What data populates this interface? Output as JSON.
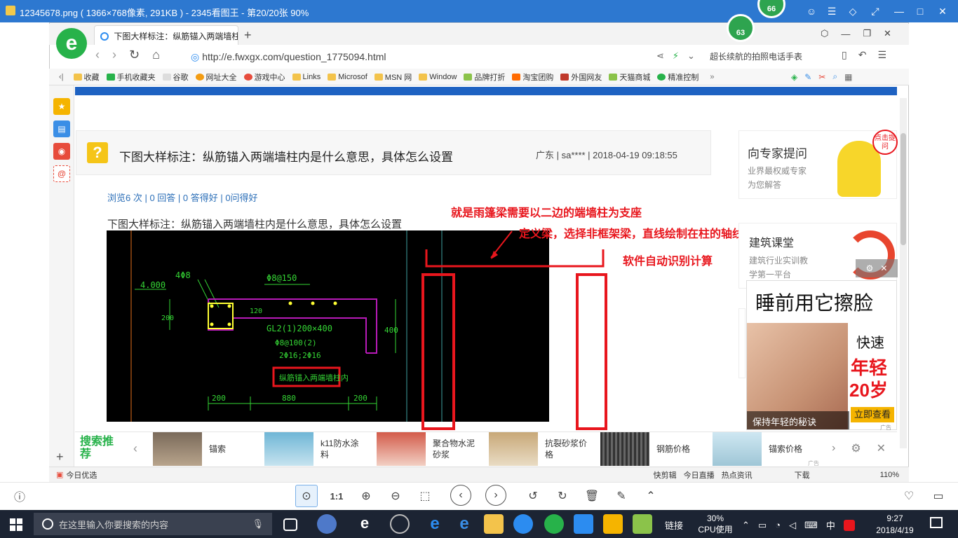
{
  "viewer": {
    "title": "12345678.png ( 1366×768像素, 291KB ) - 2345看图王 - 第20/20张 90%",
    "badge_top": "66",
    "badge_browser": "63"
  },
  "browser": {
    "tab_title": "下图大样标注：纵筋锚入两端墙柱",
    "url": "http://e.fwxgx.com/question_1775094.html",
    "right_promo": "超长续航的拍照电话手表",
    "bookmarks": [
      "收藏",
      "手机收藏夹",
      "谷歌",
      "网址大全",
      "游戏中心",
      "Links",
      "Microsof",
      "MSN 网",
      "Window",
      "品牌打折",
      "淘宝团购",
      "外国网友",
      "天猫商城",
      "精准控制"
    ]
  },
  "question": {
    "title": "下图大样标注：纵筋锚入两端墙柱内是什么意思，具体怎么设置",
    "meta": "广东 | sa**** | 2018-04-19 09:18:55",
    "stats": "浏览6 次 | 0 回答 | 0 答得好 | 0问得好",
    "body": "下图大样标注：纵筋锚入两端墙柱内是什么意思，具体怎么设置"
  },
  "annotations": {
    "line1": "就是雨篷梁需要以二边的端墙柱为支座",
    "line2": "定义梁，选择非框架梁，直线绘制在柱的轴线上面",
    "line3": "软件自动识别计算"
  },
  "cad": {
    "elev": "4.000",
    "rebar_top": "4Φ8",
    "stirrup": "Φ8@150",
    "beam_name": "GL2(1)200×400",
    "beam_stirrup": "Φ8@100(2)",
    "beam_rebar": "2Φ16;2Φ16",
    "note": "纵筋锚入两端墙柱内",
    "dim_left": "200",
    "dim_mid": "880",
    "dim_right": "200",
    "dim_h": "400",
    "dim_120": "120",
    "dim_200v": "200"
  },
  "sidebar_right": {
    "ask_title": "向专家提问",
    "ask_sub1": "业界最权威专家",
    "ask_sub2": "为您解答",
    "bubble": "点击提问",
    "course_title": "建筑课堂",
    "course_sub1": "建筑行业实训教",
    "course_sub2": "学第一平台",
    "ad_head": "睡前用它擦脸",
    "ad_fast": "快速",
    "ad_young": "年轻",
    "ad_20": "20岁",
    "ad_caption": "保持年轻的秘诀",
    "ad_button": "立即查看",
    "ad_tag": "广告"
  },
  "bottom_ads": {
    "label": "搜索推荐",
    "items": [
      "锚索",
      "k11防水涂料",
      "聚合物水泥砂浆",
      "抗裂砂浆价格",
      "钢筋价格",
      "锚索价格"
    ],
    "ad_tag": "广告"
  },
  "statusbar": {
    "left": "今日优选",
    "items": [
      "快剪辑",
      "今日直播",
      "热点资讯",
      "下载",
      "110%"
    ]
  },
  "viewer_toolbar": {
    "ratio": "1:1"
  },
  "taskbar": {
    "search_placeholder": "在这里输入你要搜索的内容",
    "link": "链接",
    "cpu_pct": "30%",
    "cpu_label": "CPU使用",
    "ime": "中",
    "time": "9:27",
    "date": "2018/4/19"
  },
  "colors": {
    "viewer_blue": "#2d78d0",
    "annotation_red": "#e8161d",
    "cad_green": "#35d635",
    "cad_magenta": "#b81ab8",
    "taskbar": "#1c2433"
  }
}
